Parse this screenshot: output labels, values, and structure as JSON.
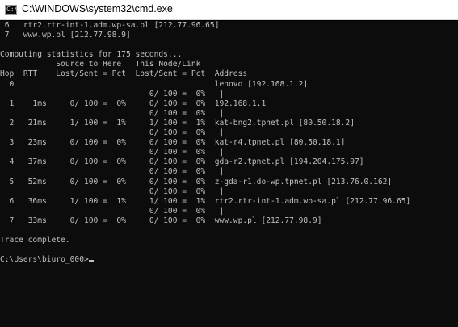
{
  "window": {
    "title": "C:\\WINDOWS\\system32\\cmd.exe",
    "icon": "cmd-icon",
    "icon_glyph": "C:\\"
  },
  "console": {
    "lines": [
      " 6   rtr2.rtr-int-1.adm.wp-sa.pl [212.77.96.65]",
      " 7   www.wp.pl [212.77.98.9]",
      "",
      "Computing statistics for 175 seconds...",
      "            Source to Here   This Node/Link",
      "Hop  RTT    Lost/Sent = Pct  Lost/Sent = Pct  Address",
      "  0                                           lenovo [192.168.1.2]",
      "                                0/ 100 =  0%   |",
      "  1    1ms     0/ 100 =  0%     0/ 100 =  0%  192.168.1.1",
      "                                0/ 100 =  0%   |",
      "  2   21ms     1/ 100 =  1%     1/ 100 =  1%  kat-bng2.tpnet.pl [80.50.18.2]",
      "                                0/ 100 =  0%   |",
      "  3   23ms     0/ 100 =  0%     0/ 100 =  0%  kat-r4.tpnet.pl [80.50.18.1]",
      "                                0/ 100 =  0%   |",
      "  4   37ms     0/ 100 =  0%     0/ 100 =  0%  gda-r2.tpnet.pl [194.204.175.97]",
      "                                0/ 100 =  0%   |",
      "  5   52ms     0/ 100 =  0%     0/ 100 =  0%  z-gda-r1.do-wp.tpnet.pl [213.76.0.162]",
      "                                0/ 100 =  0%   |",
      "  6   36ms     1/ 100 =  1%     1/ 100 =  1%  rtr2.rtr-int-1.adm.wp-sa.pl [212.77.96.65]",
      "                                0/ 100 =  0%   |",
      "  7   33ms     0/ 100 =  0%     0/ 100 =  0%  www.wp.pl [212.77.98.9]",
      "",
      "Trace complete.",
      ""
    ],
    "prompt": "C:\\Users\\biuro_000>",
    "colors": {
      "background": "#0c0c0c",
      "foreground": "#c0c0c0",
      "titlebar": "#ffffff"
    }
  }
}
